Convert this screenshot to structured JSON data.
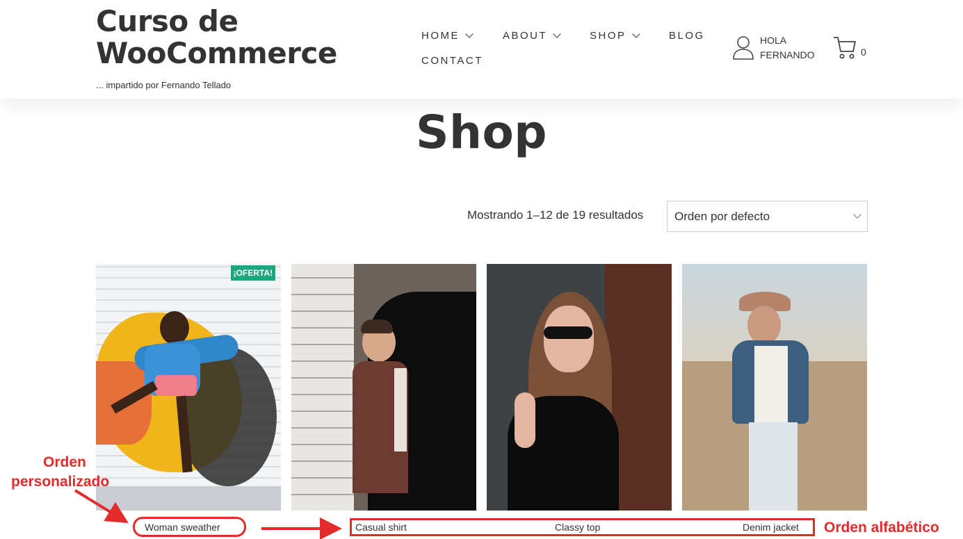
{
  "header": {
    "logo_line1": "Curso de",
    "logo_line2": "WooCommerce",
    "tagline": "... impartido por Fernando Tellado",
    "nav": {
      "home": "HOME",
      "about": "ABOUT",
      "shop": "SHOP",
      "blog": "BLOG",
      "contact": "CONTACT"
    },
    "account_line1": "HOLA",
    "account_line2": "FERNANDO",
    "cart_count": "0"
  },
  "page_title": "Shop",
  "toolbar": {
    "result_count": "Mostrando 1–12 de 19 resultados",
    "orderby_selected": "Orden por defecto"
  },
  "products": [
    {
      "name": "Woman sweather",
      "badge": "¡OFERTA!"
    },
    {
      "name": "Casual shirt"
    },
    {
      "name": "Classy top"
    },
    {
      "name": "Denim jacket"
    }
  ],
  "annotations": {
    "custom_order_line1": "Orden",
    "custom_order_line2": "personalizado",
    "alpha_order": "Orden alfabético"
  },
  "colors": {
    "accent_badge": "#1ea67f",
    "annotation_red": "#e32b2b",
    "text": "#333333"
  }
}
